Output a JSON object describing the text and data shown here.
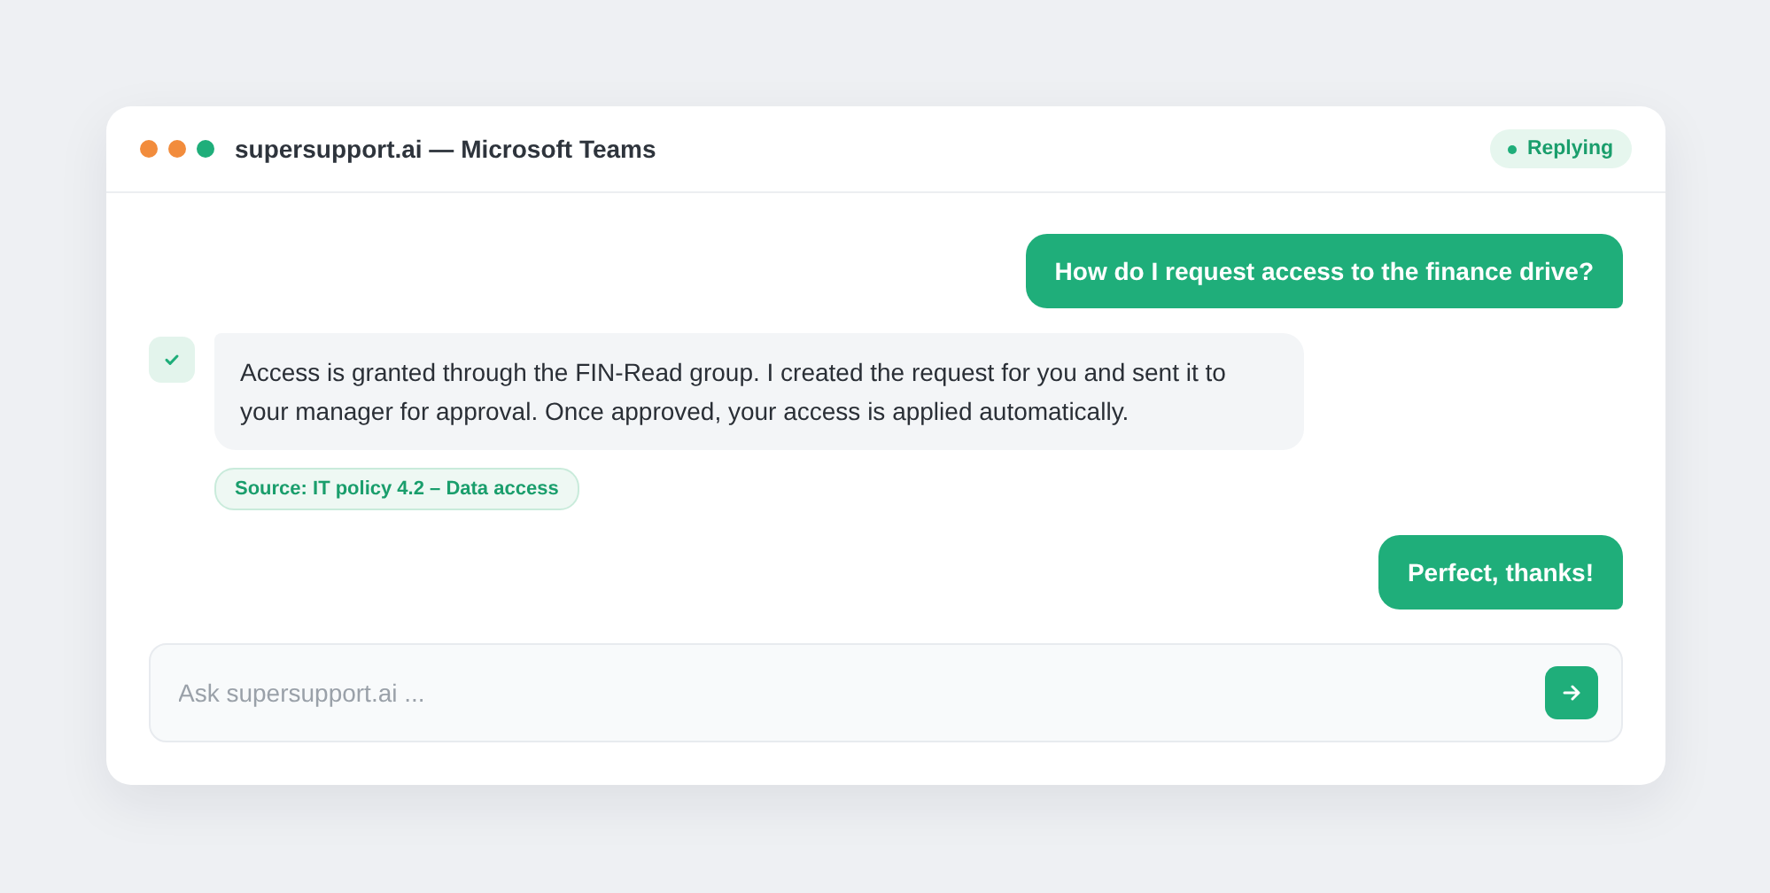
{
  "window": {
    "title": "supersupport.ai — Microsoft Teams",
    "dots": [
      {
        "color": "#f28c3c"
      },
      {
        "color": "#f28c3c"
      },
      {
        "color": "#1fae7a"
      }
    ],
    "status": "Replying"
  },
  "messages": [
    {
      "kind": "user",
      "text": "How do I request access to the finance drive?"
    },
    {
      "kind": "bot",
      "text": "Access is granted through the FIN-Read group. I created the request for you and sent it to your manager for approval. Once approved, your access is applied automatically.",
      "source": "Source: IT policy 4.2 – Data access"
    },
    {
      "kind": "user",
      "text": "Perfect, thanks!"
    }
  ],
  "composer": {
    "placeholder": "Ask supersupport.ai ..."
  }
}
